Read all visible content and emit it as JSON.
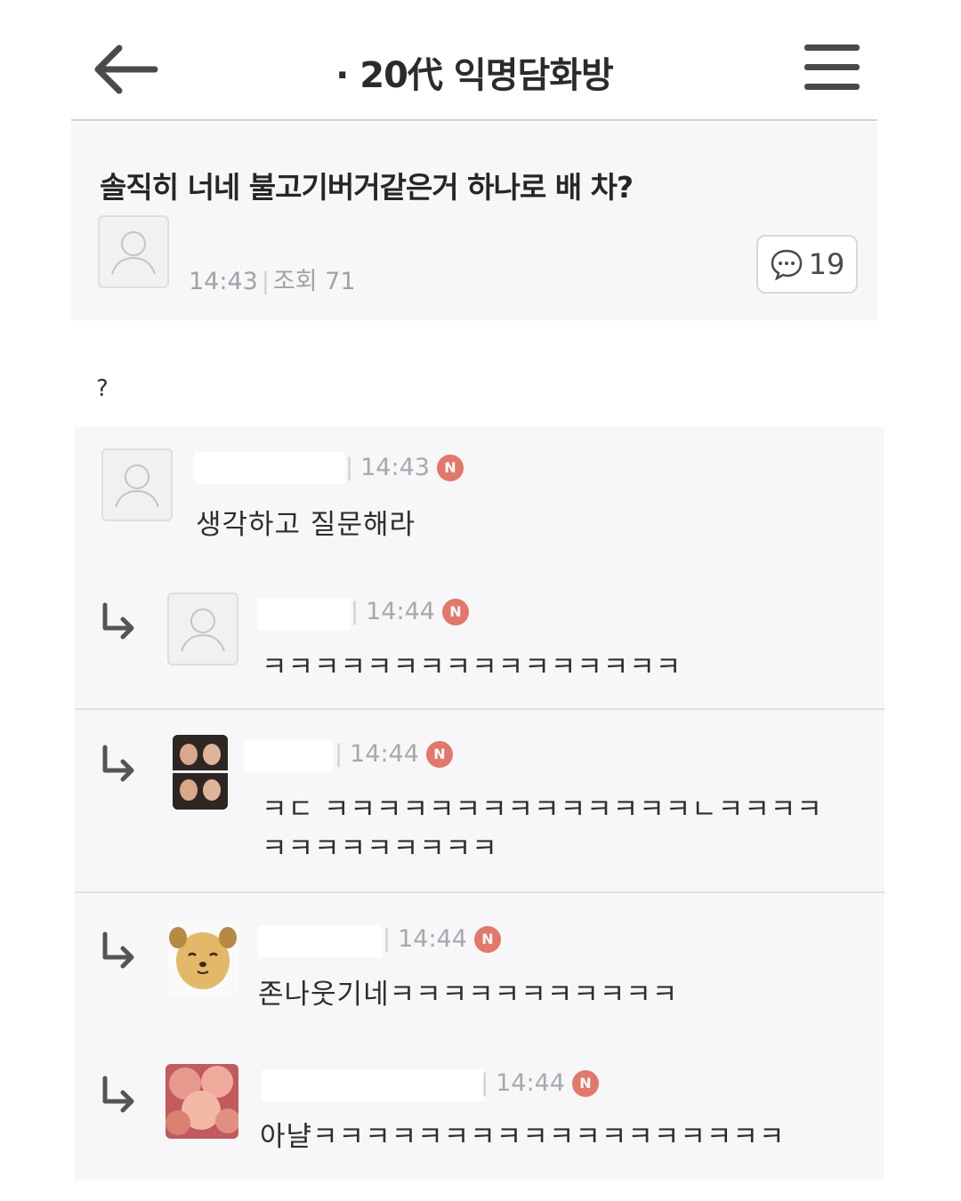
{
  "header": {
    "title": "· 20代 익명담화방",
    "back_icon": "arrow-left-icon",
    "menu_icon": "hamburger-menu-icon"
  },
  "post": {
    "title": "솔직히 너네 불고기버거같은거 하나로 배 차?",
    "time": "14:43",
    "views_label": "조회 71",
    "comment_count": "19",
    "body": "?"
  },
  "comments": [
    {
      "time": "14:43",
      "badge": "N",
      "text": "생각하고 질문해라",
      "reply": false,
      "avatar": "default"
    },
    {
      "time": "14:44",
      "badge": "N",
      "text": "ㅋㅋㅋㅋㅋㅋㅋㅋㅋㅋㅋㅋㅋㅋㅋㅋ",
      "reply": true,
      "avatar": "default"
    },
    {
      "time": "14:44",
      "badge": "N",
      "text": "ㅋㄷ ㅋㅋㅋㅋㅋㅋㅋㅋㅋㅋㅋㅋㅋㅋㄴㅋㅋㅋㅋ",
      "text2": "ㅋㅋㅋㅋㅋㅋㅋㅋㅋ",
      "reply": true,
      "avatar": "photo-people"
    },
    {
      "time": "14:44",
      "badge": "N",
      "text": "존나웃기네ㅋㅋㅋㅋㅋㅋㅋㅋㅋㅋㅋ",
      "reply": true,
      "avatar": "dog-character"
    },
    {
      "time": "14:44",
      "badge": "N",
      "text": "아냘ㅋㅋㅋㅋㅋㅋㅋㅋㅋㅋㅋㅋㅋㅋㅋㅋㅋㅋ",
      "reply": true,
      "avatar": "photo-peach"
    }
  ],
  "colors": {
    "badge": "#e2776a",
    "card_bg": "#f7f7f9",
    "meta_text": "#a2a2a6"
  }
}
